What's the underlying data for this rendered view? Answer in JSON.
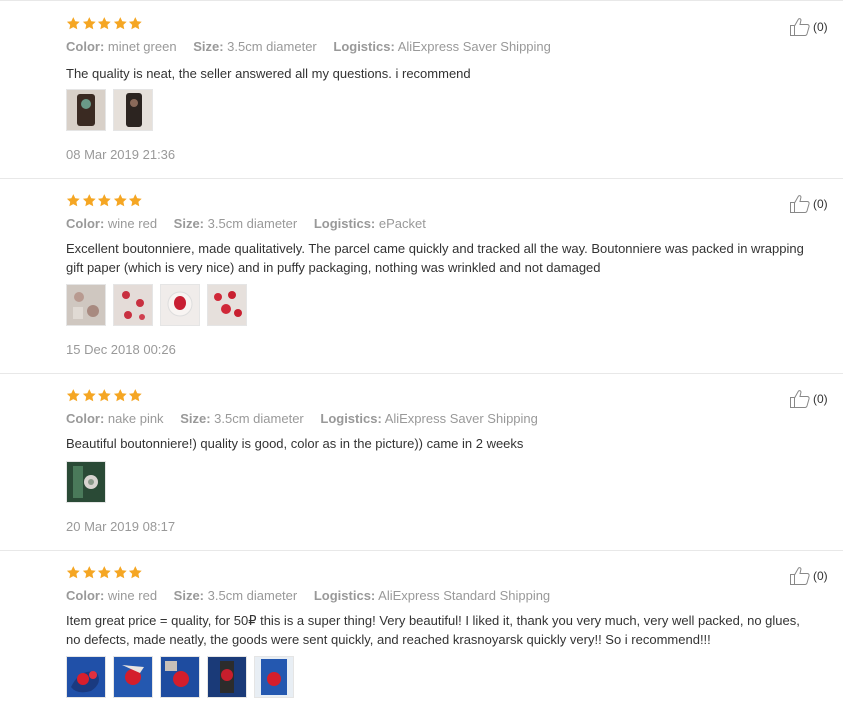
{
  "colors": {
    "star": "#f5a623",
    "meta": "#999999",
    "text": "#333333",
    "divider": "#e8e8e8"
  },
  "labels": {
    "color": "Color:",
    "size": "Size:",
    "logistics": "Logistics:"
  },
  "reviews": [
    {
      "rating": 5,
      "color": "minet green",
      "size": "3.5cm diameter",
      "logistics": "AliExpress Saver Shipping",
      "text": "The quality is neat, the seller answered all my questions. i recommend",
      "photos": [
        "review-photo",
        "review-photo"
      ],
      "date": "08 Mar 2019 21:36",
      "likes": "(0)"
    },
    {
      "rating": 5,
      "color": "wine red",
      "size": "3.5cm diameter",
      "logistics": "ePacket",
      "text": "Excellent boutonniere, made qualitatively. The parcel came quickly and tracked all the way. Boutonniere was packed in wrapping gift paper (which is very nice) and in puffy packaging, nothing was wrinkled and not damaged",
      "photos": [
        "review-photo",
        "review-photo",
        "review-photo",
        "review-photo"
      ],
      "date": "15 Dec 2018 00:26",
      "likes": "(0)"
    },
    {
      "rating": 5,
      "color": "nake pink",
      "size": "3.5cm diameter",
      "logistics": "AliExpress Saver Shipping",
      "text": "Beautiful boutonniere!) quality is good, color as in the picture)) came in 2 weeks",
      "photos": [
        "review-photo"
      ],
      "date": "20 Mar 2019 08:17",
      "likes": "(0)"
    },
    {
      "rating": 5,
      "color": "wine red",
      "size": "3.5cm diameter",
      "logistics": "AliExpress Standard Shipping",
      "text": "Item great price = quality, for 50₽ this is a super thing! Very beautiful! I liked it, thank you very much, very well packed, no glues, no defects, made neatly, the goods were sent quickly, and reached krasnoyarsk quickly very!! So i recommend!!!",
      "photos": [
        "review-photo",
        "review-photo",
        "review-photo",
        "review-photo",
        "review-photo"
      ],
      "date": "",
      "likes": "(0)"
    }
  ],
  "icons": {
    "star": "star-icon",
    "like": "thumbs-up-icon"
  }
}
